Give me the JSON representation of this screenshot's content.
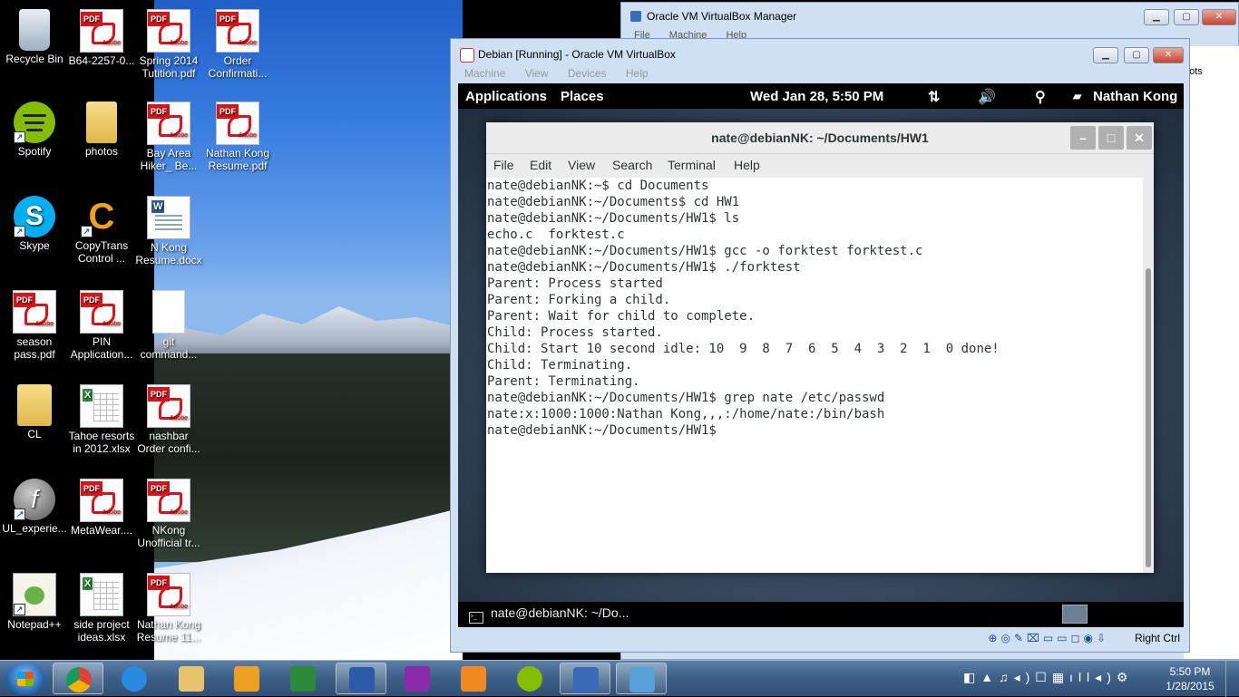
{
  "desktop": {
    "icons": [
      {
        "label": "Recycle Bin",
        "icon": "recycle-bin-icon"
      },
      {
        "label": "B64-2257-0...",
        "icon": "pdf-icon"
      },
      {
        "label": "Spring 2014 Tutition.pdf",
        "icon": "pdf-icon"
      },
      {
        "label": "Order Confirmati...",
        "icon": "pdf-icon"
      },
      {
        "label": "Spotify",
        "icon": "spotify-icon"
      },
      {
        "label": "photos",
        "icon": "folder-icon"
      },
      {
        "label": "Bay Area Hiker_ Be...",
        "icon": "pdf-icon"
      },
      {
        "label": "Nathan Kong Resume.pdf",
        "icon": "pdf-icon"
      },
      {
        "label": "Skype",
        "icon": "skype-icon"
      },
      {
        "label": "CopyTrans Control ...",
        "icon": "copytrans-icon"
      },
      {
        "label": "N Kong Resume.docx",
        "icon": "word-doc-icon"
      },
      {
        "label": "season pass.pdf",
        "icon": "pdf-icon"
      },
      {
        "label": "PIN Application...",
        "icon": "pdf-icon"
      },
      {
        "label": "git command...",
        "icon": "text-file-icon"
      },
      {
        "label": "CL",
        "icon": "folder-icon"
      },
      {
        "label": "Tahoe resorts in 2012.xlsx",
        "icon": "excel-icon"
      },
      {
        "label": "nashbar Order confi...",
        "icon": "pdf-icon"
      },
      {
        "label": "UL_experie...",
        "icon": "flash-icon"
      },
      {
        "label": "MetaWear....",
        "icon": "pdf-icon"
      },
      {
        "label": "NKong Unofficial tr...",
        "icon": "pdf-icon"
      },
      {
        "label": "Notepad++",
        "icon": "notepadpp-icon"
      },
      {
        "label": "side project ideas.xlsx",
        "icon": "excel-icon"
      },
      {
        "label": "Nathan Kong Resume 11...",
        "icon": "pdf-icon"
      }
    ]
  },
  "vbox_manager": {
    "title": "Oracle VM VirtualBox Manager",
    "menu": [
      "File",
      "Machine",
      "Help"
    ],
    "side_text": "hots"
  },
  "vm_window": {
    "title": "Debian [Running] - Oracle VM VirtualBox",
    "menu": [
      "Machine",
      "View",
      "Devices",
      "Help"
    ],
    "host_key": "Right Ctrl"
  },
  "gnome": {
    "applications": "Applications",
    "places": "Places",
    "clock": "Wed Jan 28,  5:50 PM",
    "user": "Nathan Kong",
    "taskbar_item": "nate@debianNK: ~/Do..."
  },
  "terminal": {
    "title": "nate@debianNK: ~/Documents/HW1",
    "menu": [
      "File",
      "Edit",
      "View",
      "Search",
      "Terminal",
      "Help"
    ],
    "lines": [
      "nate@debianNK:~$ cd Documents",
      "nate@debianNK:~/Documents$ cd HW1",
      "nate@debianNK:~/Documents/HW1$ ls",
      "echo.c  forktest.c",
      "nate@debianNK:~/Documents/HW1$ gcc -o forktest forktest.c",
      "nate@debianNK:~/Documents/HW1$ ./forktest",
      "Parent: Process started",
      "Parent: Forking a child.",
      "Parent: Wait for child to complete.",
      "Child: Process started.",
      "Child: Start 10 second idle: 10  9  8  7  6  5  4  3  2  1  0 done!",
      "Child: Terminating.",
      "Parent: Terminating.",
      "nate@debianNK:~/Documents/HW1$ grep nate /etc/passwd",
      "nate:x:1000:1000:Nathan Kong,,,:/home/nate:/bin/bash",
      "nate@debianNK:~/Documents/HW1$ "
    ]
  },
  "taskbar": {
    "clock_time": "5:50 PM",
    "clock_date": "1/28/2015",
    "pinned": [
      {
        "icon": "chrome-icon",
        "color": "#e33b2e"
      },
      {
        "icon": "internet-explorer-icon",
        "color": "#2a8ae0"
      },
      {
        "icon": "file-explorer-icon",
        "color": "#e8c36a"
      },
      {
        "icon": "media-player-icon",
        "color": "#f0a020"
      },
      {
        "icon": "excel-icon",
        "color": "#2a8a3a"
      },
      {
        "icon": "word-icon",
        "color": "#2a5aa8"
      },
      {
        "icon": "onenote-icon",
        "color": "#8a2aa8"
      },
      {
        "icon": "settings-gear-icon",
        "color": "#f08a20"
      },
      {
        "icon": "spotify-icon",
        "color": "#84bd00"
      },
      {
        "icon": "virtualbox-icon",
        "color": "#3a6ab8"
      },
      {
        "icon": "photo-viewer-icon",
        "color": "#5aa0d8"
      }
    ]
  }
}
